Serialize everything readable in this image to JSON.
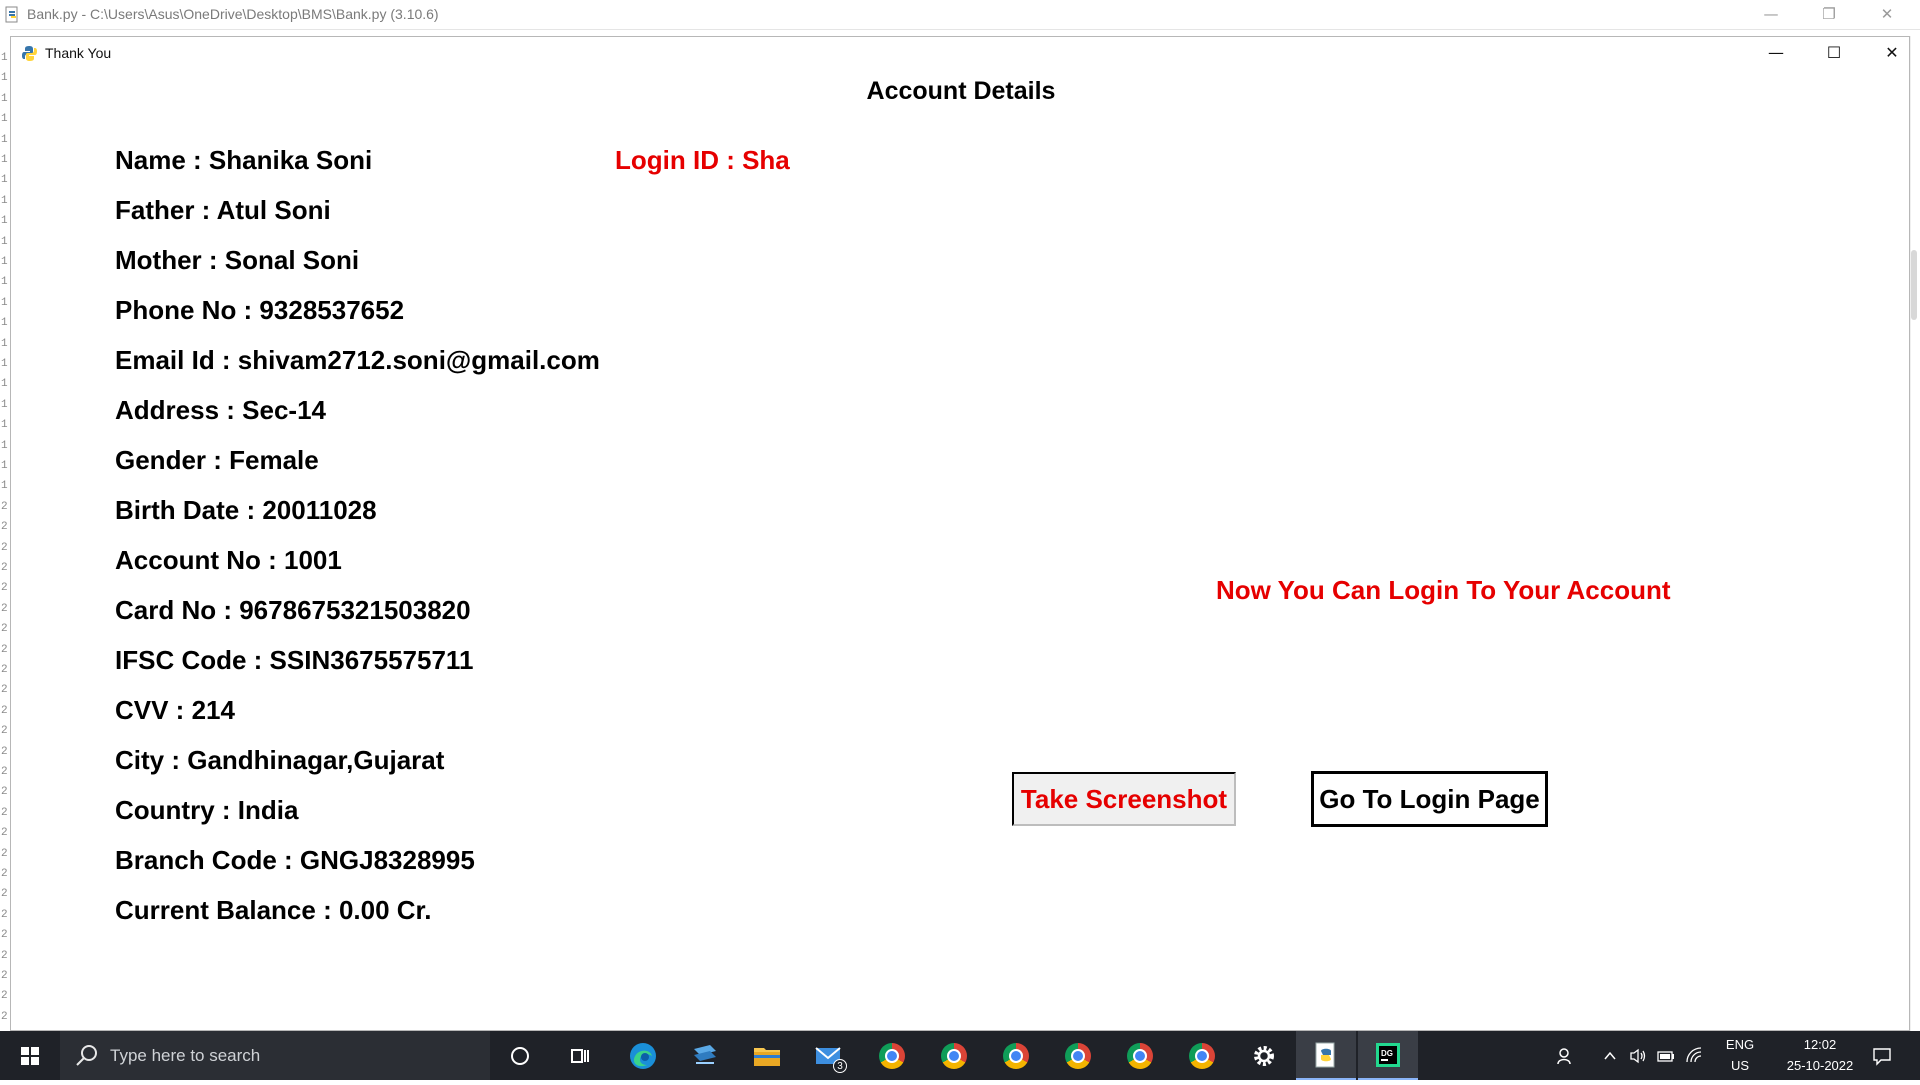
{
  "background_window": {
    "title": "Bank.py - C:\\Users\\Asus\\OneDrive\\Desktop\\BMS\\Bank.py (3.10.6)",
    "gutter_lines": [
      "1",
      "1",
      "1",
      "1",
      "1",
      "1",
      "1",
      "1",
      "1",
      "1",
      "1",
      "1",
      "1",
      "1",
      "1",
      "1",
      "1",
      "1",
      "1",
      "1",
      "1",
      "1",
      "2",
      "2",
      "2",
      "2",
      "2",
      "2",
      "2",
      "2",
      "2",
      "2",
      "2",
      "2",
      "2",
      "2",
      "2",
      "2",
      "2",
      "2",
      "2",
      "2",
      "2",
      "2",
      "2",
      "2",
      "2",
      "2",
      "2"
    ]
  },
  "dialog": {
    "title": "Thank You",
    "heading": "Account Details",
    "details": [
      "Name : Shanika Soni",
      "Father : Atul Soni",
      "Mother : Sonal Soni",
      "Phone No : 9328537652",
      "Email Id : shivam2712.soni@gmail.com",
      "Address : Sec-14",
      "Gender : Female",
      "Birth Date : 20011028",
      "Account No : 1001",
      "Card No : 9678675321503820",
      "IFSC Code : SSIN3675575711",
      "CVV : 214",
      "City : Gandhinagar,Gujarat",
      "Country : India",
      "Branch Code : GNGJ8328995",
      "Current Balance : 0.00 Cr."
    ],
    "login_id": "Login ID : Sha",
    "message": "Now You Can Login To Your Account",
    "screenshot_button": "Take Screenshot",
    "login_button": "Go To Login Page",
    "accent_color": "#e60000"
  },
  "taskbar": {
    "search_placeholder": "Type here to search",
    "mail_badge": "3",
    "language_line1": "ENG",
    "language_line2": "US",
    "time": "12:02",
    "date": "25-10-2022"
  }
}
